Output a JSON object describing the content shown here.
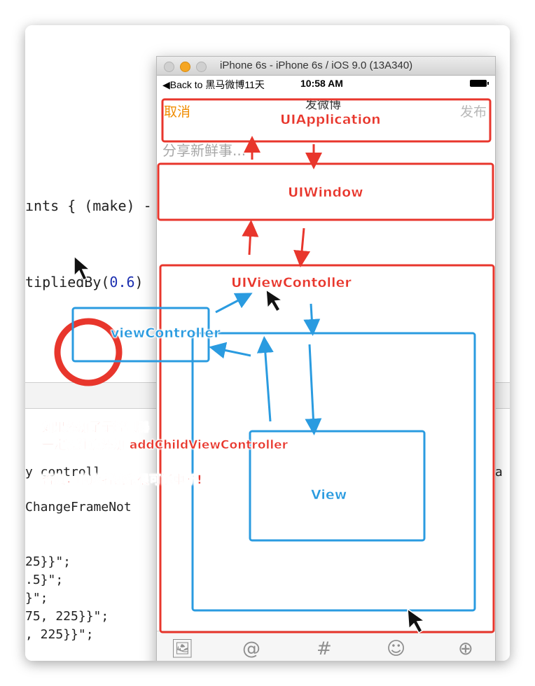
{
  "editor": {
    "code_lines": [
      "ınts { (make) -",
      "tipliedBy(0.6)",
      "y controll",
      "ChangeFrameNot",
      "25}}\";",
      ".5}\";",
      "}\";",
      "75, 225}}\";",
      ", 225}}\";"
    ],
    "right_fragment": "ra"
  },
  "simulator": {
    "window_title": "iPhone 6s - iPhone 6s / iOS 9.0 (13A340)",
    "status_back": "◀Back to 黑马微博11天",
    "status_time": "10:58 AM",
    "nav_cancel": "取消",
    "nav_title": "发微博",
    "nav_publish": "发布",
    "text_placeholder": "分享新鲜事...",
    "toolbar_icons": [
      "image-icon",
      "at-icon",
      "hashtag-icon",
      "emoji-icon",
      "add-icon"
    ],
    "toolbar_glyphs": [
      "🖼",
      "@",
      "#",
      "☺",
      "⊕"
    ]
  },
  "annotations": {
    "uiapplication": "UIApplication",
    "uiwindow": "UIWindow",
    "uiviewcontroller": "UIViewContoller",
    "viewcontroller": "viewController",
    "view": "View",
    "note1": "如果添加了子控制器",
    "note2": "一定要注意添加 addChildViewController",
    "note3": "否则，响应者链条很可能中断!"
  },
  "colors": {
    "annotation_red": "#e8362c",
    "annotation_blue": "#2a9be0",
    "cancel_orange": "#f08c00"
  }
}
